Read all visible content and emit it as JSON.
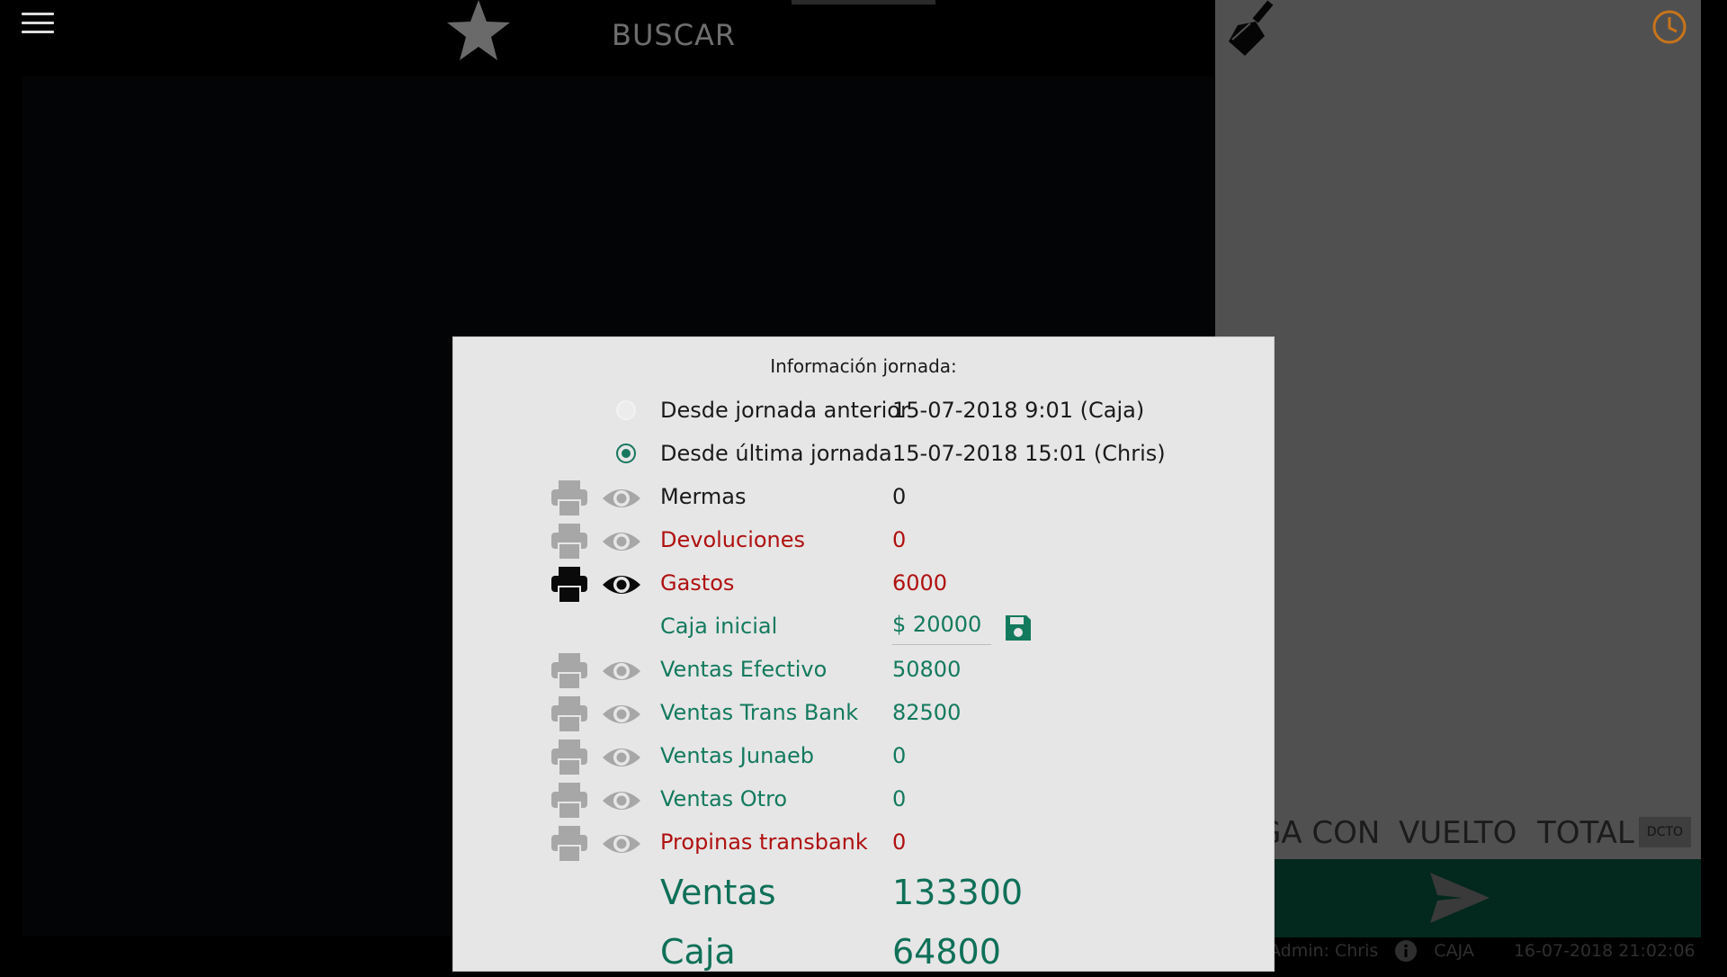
{
  "topbar": {
    "search_label": "BUSCAR",
    "icons": [
      "menu-icon",
      "star-icon",
      "broom-icon",
      "clock-icon"
    ]
  },
  "right_panel": {
    "columns": [
      "GA CON",
      "VUELTO",
      "TOTAL"
    ],
    "dcto_label": "DCTO"
  },
  "status": {
    "admin": "Admin: Chris",
    "mode": "CAJA",
    "datetime": "16-07-2018 21:02:06"
  },
  "dialog": {
    "title": "Información jornada:",
    "options": [
      {
        "label": "Desde jornada anterior",
        "value": "15-07-2018  9:01 (Caja)",
        "selected": false
      },
      {
        "label": "Desde última jornada",
        "value": "15-07-2018  15:01 (Chris)",
        "selected": true
      }
    ],
    "rows": [
      {
        "label": "Mermas",
        "value": "0",
        "color": "dark",
        "active": false
      },
      {
        "label": "Devoluciones",
        "value": "0",
        "color": "red",
        "active": false
      },
      {
        "label": "Gastos",
        "value": "6000",
        "color": "red",
        "active": true
      }
    ],
    "caja_inicial": {
      "label": "Caja inicial",
      "currency": "$",
      "value": "20000"
    },
    "sales_rows": [
      {
        "label": "Ventas Efectivo",
        "value": "50800",
        "color": "green"
      },
      {
        "label": "Ventas Trans Bank",
        "value": "82500",
        "color": "green"
      },
      {
        "label": "Ventas Junaeb",
        "value": "0",
        "color": "green"
      },
      {
        "label": "Ventas Otro",
        "value": "0",
        "color": "green"
      },
      {
        "label": "Propinas transbank",
        "value": "0",
        "color": "red"
      }
    ],
    "totals": [
      {
        "label": "Ventas",
        "value": "133300"
      },
      {
        "label": "Caja",
        "value": "64800"
      }
    ]
  },
  "colors": {
    "accent_green": "#137a5e",
    "alert_red": "#b01010",
    "clock_orange": "#c8741a"
  }
}
